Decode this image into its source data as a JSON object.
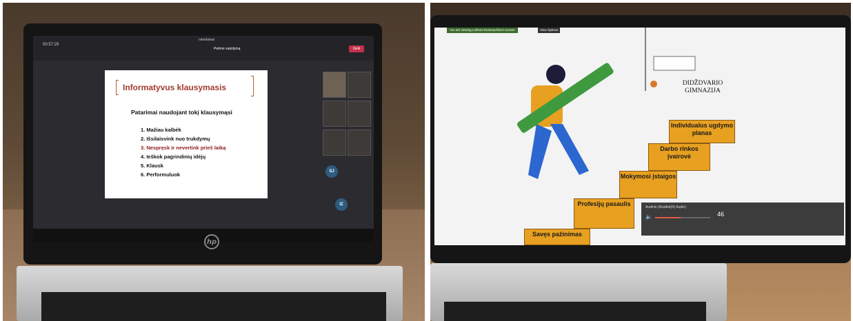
{
  "left_screen": {
    "window_title": "nėrinkimai",
    "timer": "00:57:29",
    "stop_share_label": "Petrinė vaizdymą",
    "leave_label": "Išeiti",
    "slide": {
      "title": "Informatyvus klausymasis",
      "subtitle": "Patarimai naudojant tokį klausymąsi",
      "items": [
        {
          "text": "1. Mažiau kalbėk"
        },
        {
          "text": "2. Išsilaisvink nuo trukdymų"
        },
        {
          "text": "3. Nespręsk ir nevertink prieš laiką",
          "red": true
        },
        {
          "text": "4. Ieškok pagrindinių idėjų"
        },
        {
          "text": "5. Klausk"
        },
        {
          "text": "6. Performuluok"
        }
      ]
    },
    "avatar_sj": "SJ",
    "avatar_iz": "IZ"
  },
  "right_screen": {
    "notice": "You are viewing Lukhuni Dominavičius's screen",
    "view_options": "View Options",
    "school_name": "DIDŽDVARIO GIMNAZIJA",
    "steps": [
      "Savęs pažinimas",
      "Profesijų pasaulis",
      "Mokymosi įstaigos",
      "Darbo rinkos įvairovė",
      "Individualus ugdymo planas"
    ],
    "audio_device": "Audinis (Realtek(R) Audio)",
    "volume": 46
  },
  "colors": {
    "slide_title": "#a33b2e",
    "step_orange": "#e8a021",
    "pencil_green": "#3f9a3f"
  }
}
